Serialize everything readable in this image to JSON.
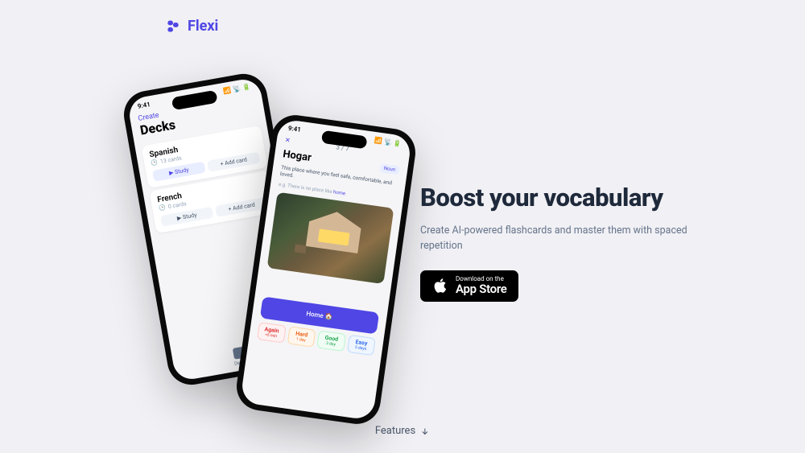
{
  "brand": {
    "name": "Flexi"
  },
  "hero": {
    "title": "Boost your vocabulary",
    "subtitle": "Create AI-powered flashcards and master them with spaced repetition"
  },
  "app_store": {
    "small": "Download on the",
    "big": "App Store"
  },
  "features": {
    "label": "Features"
  },
  "mockup": {
    "status_time": "9:41",
    "decks": {
      "create_label": "Create",
      "title": "Decks",
      "items": [
        {
          "name": "Spanish",
          "count": "13 cards",
          "study": "▶ Study",
          "add": "+ Add card"
        },
        {
          "name": "French",
          "count": "0 cards",
          "study": "▶ Study",
          "add": "+ Add card"
        }
      ],
      "nav_label": "Decks"
    },
    "card": {
      "back": "✕",
      "counter": "3 / 7",
      "word": "Hogar",
      "badge": "Noun",
      "definition": "This place where you feel safe, comfortable, and loved.",
      "example_prefix": "e.g.   There is no place like ",
      "example_highlight": "home",
      "home_btn": "Home 🏠",
      "difficulty": [
        {
          "label": "Again",
          "sub": "<5 min"
        },
        {
          "label": "Hard",
          "sub": "1 day"
        },
        {
          "label": "Good",
          "sub": "3 day"
        },
        {
          "label": "Easy",
          "sub": "5 days"
        }
      ]
    }
  }
}
